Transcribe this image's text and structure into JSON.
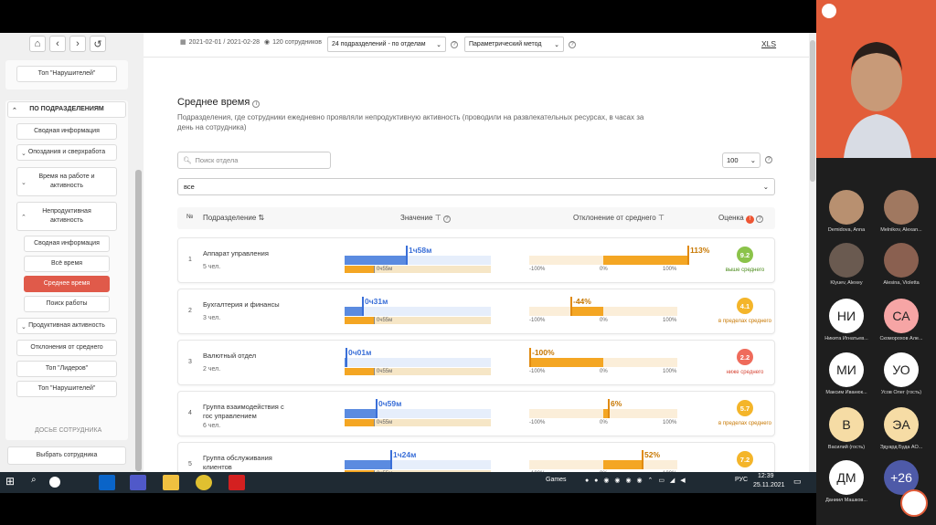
{
  "topbar": {
    "date_range": "2021-02-01 / 2021-02-28",
    "employees": "120 сотрудников",
    "group_select": "24 подразделений - по отделам",
    "method_select": "Параметрический метод",
    "xls": "XLS"
  },
  "sidebar": {
    "top_violators_1": "Топ \"Нарушителей\"",
    "section_title": "ПО ПОДРАЗДЕЛЕНИЯМ",
    "items": [
      "Сводная информация",
      "Опоздания и сверхработа",
      "Время на работе и активность",
      "Непродуктивная активность",
      "Сводная информация",
      "Всё время",
      "Среднее время",
      "Поиск работы",
      "Продуктивная активность",
      "Отклонения от среднего",
      "Топ \"Лидеров\"",
      "Топ \"Нарушителей\""
    ],
    "dossier_title": "ДОСЬЕ СОТРУДНИКА",
    "choose_employee": "Выбрать сотрудника"
  },
  "main": {
    "title": "Среднее время",
    "description": "Подразделения, где сотрудники ежедневно проявляли непродуктивную активность (проводили на развлекательных ресурсах, в часах за день на сотрудника)",
    "search_placeholder": "Поиск отдела",
    "per_page": "100",
    "filter": "все",
    "headers": {
      "num": "№",
      "dept": "Подразделение",
      "value": "Значение",
      "deviation": "Отклонение от среднего",
      "score": "Оценка"
    },
    "avg_label": "0ч55м",
    "ticks": [
      "-100%",
      "0%",
      "100%"
    ]
  },
  "rows": [
    {
      "n": "1",
      "name": "Аппарат управления",
      "count": "5 чел.",
      "value": "1ч58м",
      "value_frac": 0.42,
      "dev": "113%",
      "dev_val": 113,
      "score": "9.2",
      "score_label": "выше среднего",
      "color": "#8bc34a",
      "label_color": "#4a8a1a"
    },
    {
      "n": "2",
      "name": "Бухгалтерия и финансы",
      "count": "3 чел.",
      "value": "0ч31м",
      "value_frac": 0.12,
      "dev": "-44%",
      "dev_val": -44,
      "score": "4.1",
      "score_label": "в пределах среднего",
      "color": "#f4b52a",
      "label_color": "#c77700"
    },
    {
      "n": "3",
      "name": "Валютный отдел",
      "count": "2 чел.",
      "value": "0ч01м",
      "value_frac": 0.005,
      "dev": "-100%",
      "dev_val": -100,
      "score": "2.2",
      "score_label": "ниже среднего",
      "color": "#ef6b5b",
      "label_color": "#d64534"
    },
    {
      "n": "4",
      "name": "Группа взаимодействия с гос управлением",
      "count": "6 чел.",
      "value": "0ч59м",
      "value_frac": 0.21,
      "dev": "6%",
      "dev_val": 6,
      "score": "5.7",
      "score_label": "в пределах среднего",
      "color": "#f4b52a",
      "label_color": "#c77700"
    },
    {
      "n": "5",
      "name": "Группа обслуживания клиентов",
      "count": "",
      "value": "1ч24м",
      "value_frac": 0.31,
      "dev": "52%",
      "dev_val": 52,
      "score": "7.2",
      "score_label": "",
      "color": "#f4b52a",
      "label_color": "#c77700"
    }
  ],
  "taskbar": {
    "games": "Games",
    "lang": "РУС",
    "time": "12:39",
    "date": "25.11.2021"
  },
  "participants": [
    {
      "initials": "",
      "name": "Demidova, Anna",
      "bg": "#b89070"
    },
    {
      "initials": "",
      "name": "Melnikov, Alexan...",
      "bg": "#a07860"
    },
    {
      "initials": "",
      "name": "Klyuev, Alexey",
      "bg": "#6a5a50"
    },
    {
      "initials": "",
      "name": "Alesina, Violetta",
      "bg": "#8a6050"
    },
    {
      "initials": "НИ",
      "name": "Никита Игнатьев...",
      "bg": "#ffffff"
    },
    {
      "initials": "СА",
      "name": "Скоморохов Але...",
      "bg": "#f6a5a5"
    },
    {
      "initials": "МИ",
      "name": "Максим Иванюк...",
      "bg": "#ffffff"
    },
    {
      "initials": "УО",
      "name": "Усов Олег (гость)",
      "bg": "#ffffff"
    },
    {
      "initials": "В",
      "name": "Василий (гость)",
      "bg": "#f6dca5"
    },
    {
      "initials": "ЭА",
      "name": "Эдуард Буда АО...",
      "bg": "#f6dca5"
    },
    {
      "initials": "ДМ",
      "name": "Даниил Машков...",
      "bg": "#ffffff"
    },
    {
      "initials": "+26",
      "name": "",
      "bg": "#4e5aa8"
    }
  ]
}
